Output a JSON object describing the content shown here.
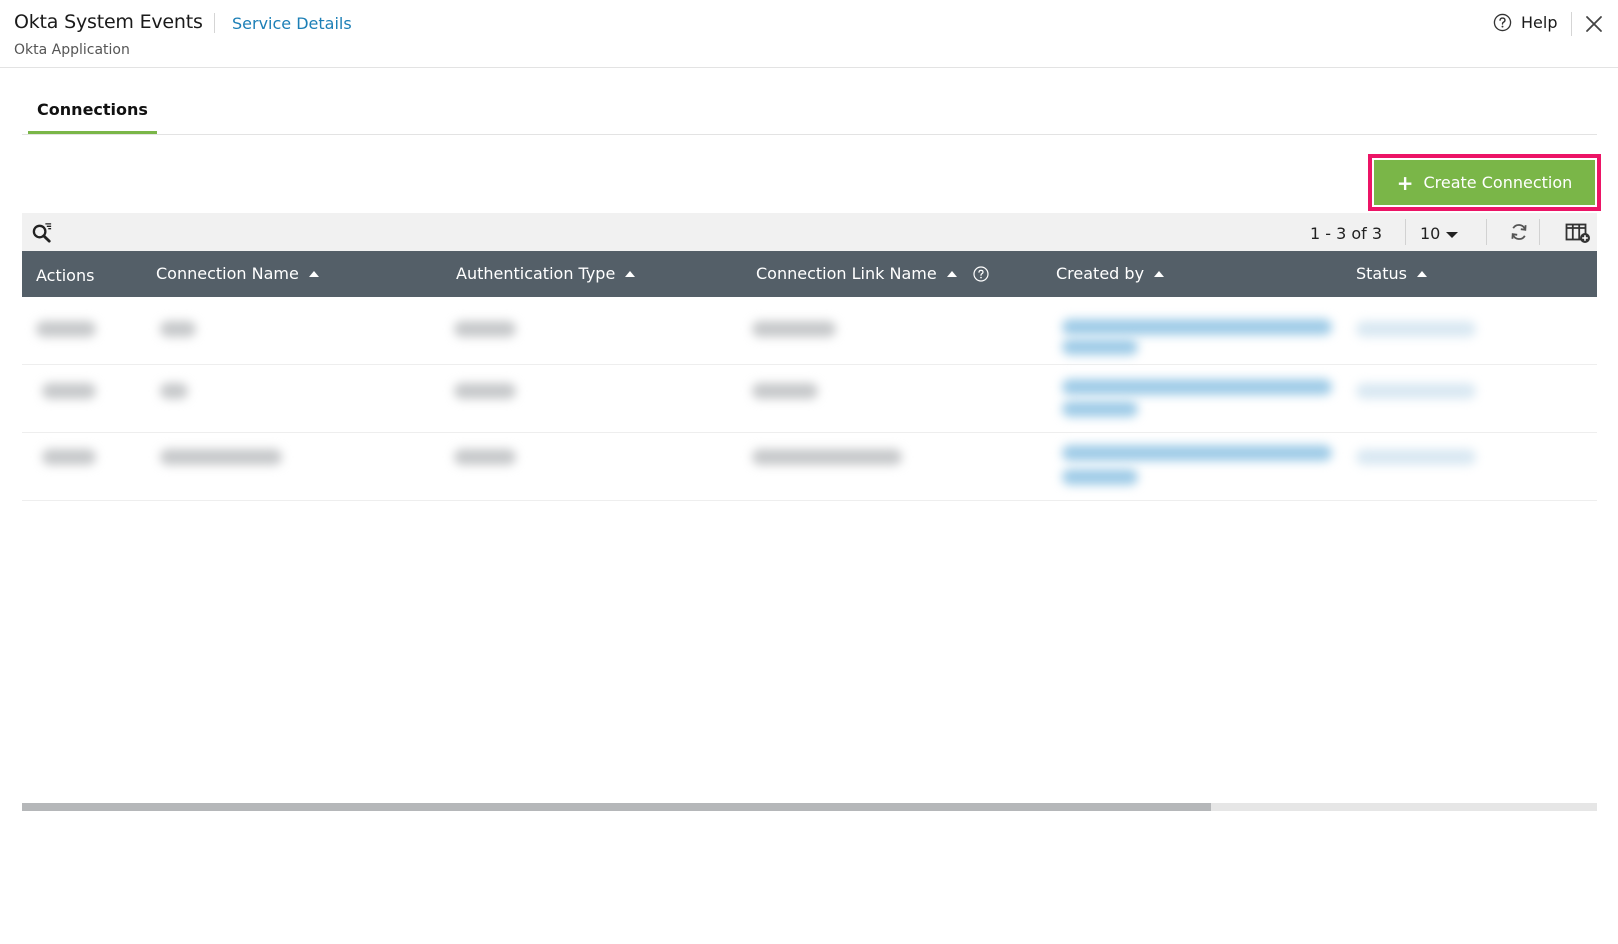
{
  "header": {
    "app_title": "Okta System Events",
    "service_link": "Service Details",
    "subtitle": "Okta Application",
    "help_label": "Help"
  },
  "tabs": [
    {
      "label": "Connections",
      "active": true
    }
  ],
  "actions": {
    "create_label": "Create Connection"
  },
  "toolbar": {
    "pager_text": "1 - 3 of 3",
    "page_size": "10"
  },
  "table": {
    "columns": [
      {
        "label": "Actions",
        "sortable": false
      },
      {
        "label": "Connection Name",
        "sortable": true
      },
      {
        "label": "Authentication Type",
        "sortable": true
      },
      {
        "label": "Connection Link Name",
        "sortable": true,
        "help": true
      },
      {
        "label": "Created by",
        "sortable": true
      },
      {
        "label": "Status",
        "sortable": true
      }
    ],
    "rows_blurred": 3
  },
  "colors": {
    "accent_green": "#7ab648",
    "header_bg": "#545f68",
    "link_blue": "#1c7fb6",
    "highlight_pink": "#ec1466"
  },
  "icons": [
    "help-circle-icon",
    "close-icon",
    "plus-icon",
    "search-filter-icon",
    "caret-down-icon",
    "refresh-icon",
    "column-add-icon",
    "sort-asc-icon",
    "question-icon"
  ]
}
